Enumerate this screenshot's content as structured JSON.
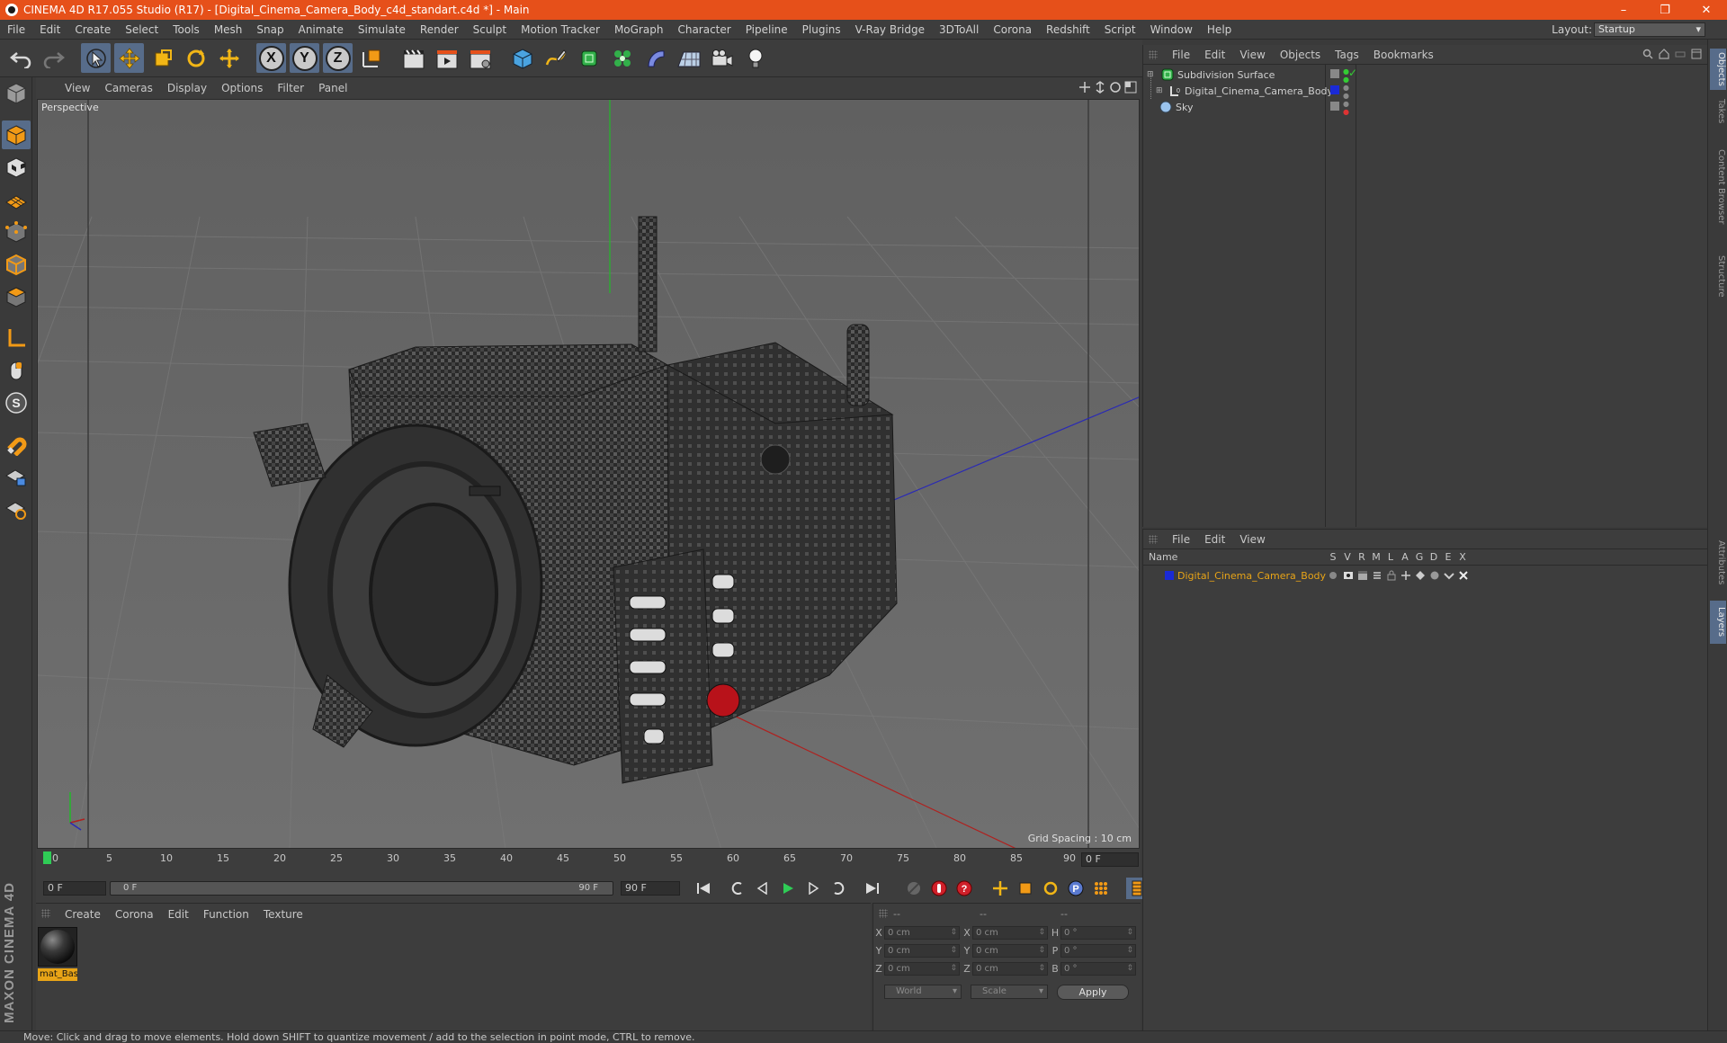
{
  "window": {
    "title": "CINEMA 4D R17.055 Studio (R17) - [Digital_Cinema_Camera_Body_c4d_standart.c4d *] - Main",
    "controls": [
      "–",
      "❐",
      "✕"
    ]
  },
  "menubar": {
    "items": [
      "File",
      "Edit",
      "Create",
      "Select",
      "Tools",
      "Mesh",
      "Snap",
      "Animate",
      "Simulate",
      "Render",
      "Sculpt",
      "Motion Tracker",
      "MoGraph",
      "Character",
      "Pipeline",
      "Plugins",
      "V-Ray Bridge",
      "3DToAll",
      "Corona",
      "Redshift",
      "Script",
      "Window",
      "Help"
    ],
    "layout_label": "Layout:",
    "layout_value": "Startup"
  },
  "toolbar": {
    "axis_x": "X",
    "axis_y": "Y",
    "axis_z": "Z"
  },
  "viewport": {
    "menu": [
      "View",
      "Cameras",
      "Display",
      "Options",
      "Filter",
      "Panel"
    ],
    "label": "Perspective",
    "grid_spacing": "Grid Spacing : 10 cm",
    "colors": {
      "background": "#6b6b6b",
      "x_axis": "#b0201e",
      "y_axis": "#22b82a",
      "z_axis": "#2a2ab4"
    }
  },
  "timeline": {
    "ticks": [
      "0",
      "5",
      "10",
      "15",
      "20",
      "25",
      "30",
      "35",
      "40",
      "45",
      "50",
      "55",
      "60",
      "65",
      "70",
      "75",
      "80",
      "85",
      "90"
    ],
    "current_frame": "0 F",
    "start_frame": "0 F",
    "range_start": "0 F",
    "range_end": "90 F",
    "end_frame": "90 F"
  },
  "material_manager": {
    "menu": [
      "Create",
      "Corona",
      "Edit",
      "Function",
      "Texture"
    ],
    "materials": [
      {
        "name": "mat_Bas"
      }
    ]
  },
  "coordinates": {
    "header": [
      "--",
      "--",
      "--"
    ],
    "rows": [
      {
        "l1": "X",
        "v1": "0 cm",
        "l2": "X",
        "v2": "0 cm",
        "l3": "H",
        "v3": "0 °"
      },
      {
        "l1": "Y",
        "v1": "0 cm",
        "l2": "Y",
        "v2": "0 cm",
        "l3": "P",
        "v3": "0 °"
      },
      {
        "l1": "Z",
        "v1": "0 cm",
        "l2": "Z",
        "v2": "0 cm",
        "l3": "B",
        "v3": "0 °"
      }
    ],
    "space": "World",
    "mode": "Scale",
    "apply": "Apply"
  },
  "object_manager": {
    "menu": [
      "File",
      "Edit",
      "View",
      "Objects",
      "Tags",
      "Bookmarks"
    ],
    "objects": [
      {
        "name": "Subdivision Surface",
        "icon": "subdivision-icon"
      },
      {
        "name": "Digital_Cinema_Camera_Body",
        "icon": "null-object-icon"
      },
      {
        "name": "Sky",
        "icon": "sky-icon"
      }
    ]
  },
  "layer_manager": {
    "menu": [
      "File",
      "Edit",
      "View"
    ],
    "columns": [
      "Name",
      "S",
      "V",
      "R",
      "M",
      "L",
      "A",
      "G",
      "D",
      "E",
      "X"
    ],
    "layers": [
      {
        "name": "Digital_Cinema_Camera_Body",
        "color": "#1a2ad6"
      }
    ]
  },
  "side_tabs": [
    "Objects",
    "Takes",
    "Content Browser",
    "Structure",
    "Attributes",
    "Layers"
  ],
  "status": {
    "text": "Move: Click and drag to move elements. Hold down SHIFT to quantize movement / add to the selection in point mode, CTRL to remove."
  },
  "branding": {
    "logo": "MAXON CINEMA 4D"
  },
  "colors": {
    "accent": "#e6501a",
    "selection": "#576c8a",
    "highlight_text": "#e8a417"
  }
}
